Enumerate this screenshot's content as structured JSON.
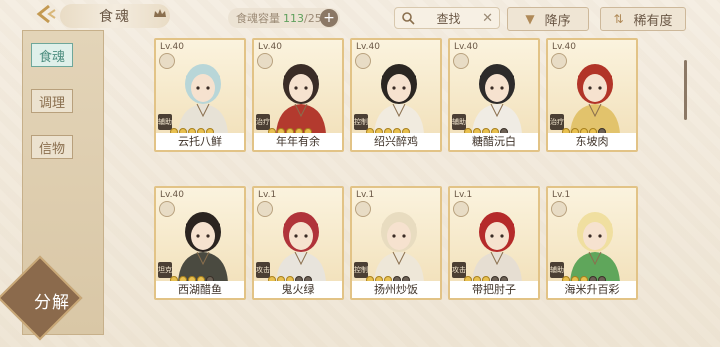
{
  "header": {
    "title": "食魂",
    "capacity_label": "食魂容量",
    "capacity_current": "113",
    "capacity_sep": "/250",
    "search_label": "查找",
    "sort_desc_label": "降序",
    "sort_rarity_label": "稀有度"
  },
  "sidebar": {
    "tabs": [
      {
        "label": "食魂"
      },
      {
        "label": "调理"
      },
      {
        "label": "信物"
      }
    ],
    "decompose_label": "分解"
  },
  "cards": [
    {
      "level": "Lv.40",
      "role": "辅助",
      "name": "云托八鲜",
      "hair": "#b8d6d8",
      "outfit": "#e7e2d6",
      "stars": 5
    },
    {
      "level": "Lv.40",
      "role": "治疗",
      "name": "年年有余",
      "hair": "#3a2c26",
      "outfit": "#b33a2e",
      "stars": 5
    },
    {
      "level": "Lv.40",
      "role": "控制",
      "name": "绍兴醉鸡",
      "hair": "#2b2622",
      "outfit": "#f1ebdf",
      "stars": 5
    },
    {
      "level": "Lv.40",
      "role": "辅助",
      "name": "糖醋沅白",
      "hair": "#2d2b2b",
      "outfit": "#f0ece4",
      "stars": 4
    },
    {
      "level": "Lv.40",
      "role": "治疗",
      "name": "东坡肉",
      "hair": "#b23428",
      "outfit": "#e2c36c",
      "stars": 4
    },
    {
      "level": "Lv.40",
      "role": "坦克",
      "name": "西湖醋鱼",
      "hair": "#2b2420",
      "outfit": "#4a4a40",
      "stars": 4
    },
    {
      "level": "Lv.1",
      "role": "攻击",
      "name": "鬼火绿",
      "hair": "#b0333a",
      "outfit": "#e8e4dc",
      "stars": 3
    },
    {
      "level": "Lv.1",
      "role": "控制",
      "name": "扬州炒饭",
      "hair": "#e8dcc0",
      "outfit": "#eee7d8",
      "stars": 3
    },
    {
      "level": "Lv.1",
      "role": "攻击",
      "name": "带把肘子",
      "hair": "#b52a2a",
      "outfit": "#e6ded2",
      "stars": 3
    },
    {
      "level": "Lv.1",
      "role": "辅助",
      "name": "海米升百彩",
      "hair": "#f0dfa0",
      "outfit": "#5fa65b",
      "stars": 3
    }
  ]
}
